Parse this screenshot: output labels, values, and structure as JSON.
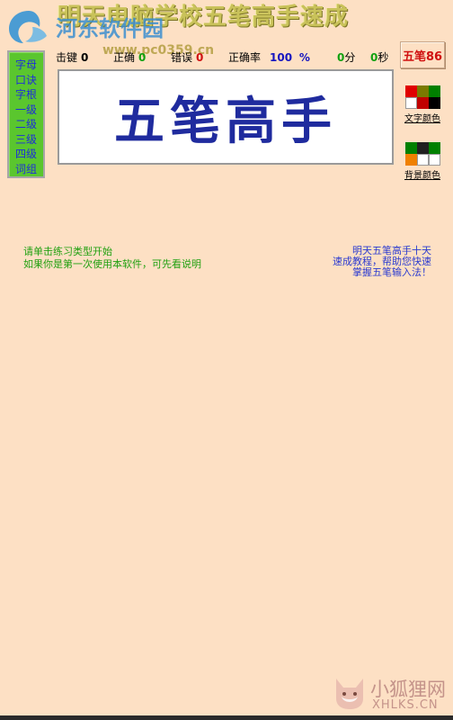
{
  "title": "明天电脑学校五笔高手速成",
  "watermark": {
    "site_name": "河东软件园",
    "url": "www.pc0359.cn",
    "bottom_cn": "小狐狸网",
    "bottom_en": "XHLKS.CN"
  },
  "side_menu": {
    "items": [
      "字母",
      "口诀",
      "字根",
      "一级",
      "二级",
      "三级",
      "四级",
      "词组"
    ]
  },
  "stats": {
    "keystrokes": {
      "label": "击键",
      "value": "0"
    },
    "correct": {
      "label": "正确",
      "value": "0"
    },
    "errors": {
      "label": "错误",
      "value": "0"
    },
    "accuracy": {
      "label": "正确率",
      "value": "100",
      "unit": "%"
    },
    "minutes": {
      "value": "0",
      "unit": "分"
    },
    "seconds": {
      "value": "0",
      "unit": "秒"
    }
  },
  "mode_button": "五笔86",
  "display_text": "五笔高手",
  "text_color": {
    "label": "文字颜色",
    "swatches": [
      "#e00000",
      "#7a7a00",
      "#008000",
      "#ffffff",
      "#c00000",
      "#000000"
    ]
  },
  "bg_color": {
    "label": "背景颜色",
    "swatches": [
      "#008000",
      "#202020",
      "#008000",
      "#f08000",
      "#ffffff",
      "#ffffff"
    ]
  },
  "hint_left": [
    "请单击练习类型开始",
    "如果你是第一次使用本软件，可先看说明"
  ],
  "hint_right": [
    "明天五笔高手十天",
    "速成教程，帮助您快速",
    "掌握五笔输入法！"
  ]
}
